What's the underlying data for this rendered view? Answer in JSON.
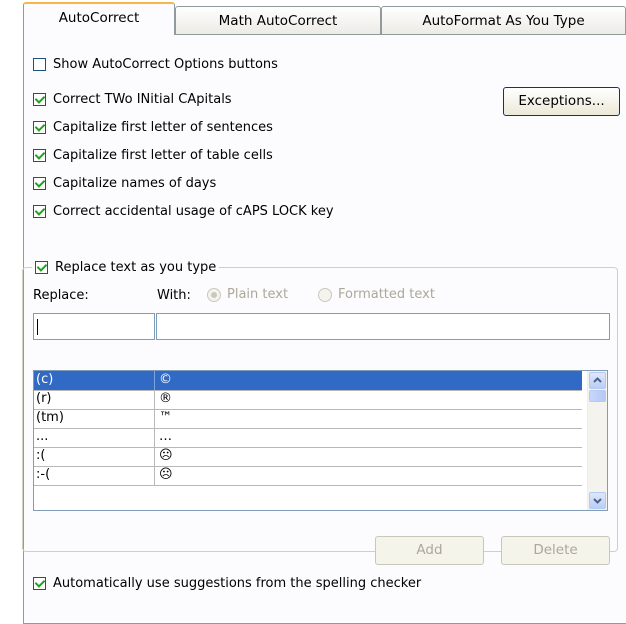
{
  "tabs": [
    {
      "label": "AutoCorrect",
      "active": true
    },
    {
      "label": "Math AutoCorrect",
      "active": false
    },
    {
      "label": "AutoFormat As You Type",
      "active": false
    }
  ],
  "options": {
    "show_buttons": {
      "label": "Show AutoCorrect Options buttons",
      "checked": false
    },
    "two_initial_caps": {
      "label": "Correct TWo INitial CApitals",
      "checked": true
    },
    "first_letter_sentences": {
      "label": "Capitalize first letter of sentences",
      "checked": true
    },
    "first_letter_cells": {
      "label": "Capitalize first letter of table cells",
      "checked": true
    },
    "names_of_days": {
      "label": "Capitalize names of days",
      "checked": true
    },
    "caps_lock": {
      "label": "Correct accidental usage of cAPS LOCK key",
      "checked": true
    }
  },
  "exceptions_button": "Exceptions...",
  "replace_group": {
    "label": "Replace text as you type",
    "checked": true,
    "replace_label": "Replace:",
    "with_label": "With:",
    "plain_text": "Plain text",
    "formatted_text": "Formatted text",
    "replace_value": "",
    "with_value": ""
  },
  "entries": [
    {
      "from": "(c)",
      "to": "©"
    },
    {
      "from": "(r)",
      "to": "®"
    },
    {
      "from": "(tm)",
      "to": "™"
    },
    {
      "from": "...",
      "to": "…"
    },
    {
      "from": ":(",
      "to": "☹"
    },
    {
      "from": ":-(",
      "to": "☹"
    }
  ],
  "add_button": "Add",
  "delete_button": "Delete",
  "spelling_suggestions": {
    "label": "Automatically use suggestions from the spelling checker",
    "checked": true
  },
  "colors": {
    "selection": "#316ac5",
    "check": "#21a121",
    "tab_highlight": "#f4b84a"
  }
}
